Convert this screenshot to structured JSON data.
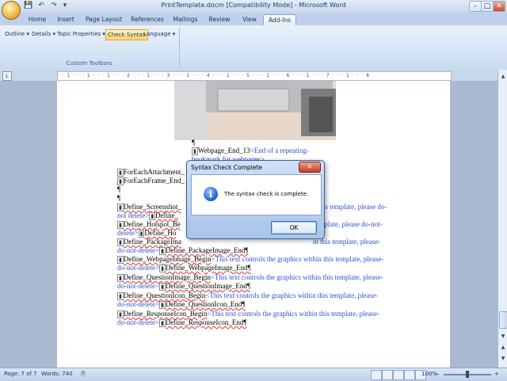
{
  "window": {
    "title": "PrintTemplate.docm [Compatibility Mode] - Microsoft Word"
  },
  "quick_access": {
    "save": "💾",
    "undo": "↶",
    "redo": "↷",
    "more": "▾"
  },
  "window_controls": {
    "minimize": "–",
    "maximize": "□",
    "close": "✕"
  },
  "tabs": [
    {
      "label": "Home"
    },
    {
      "label": "Insert"
    },
    {
      "label": "Page Layout"
    },
    {
      "label": "References"
    },
    {
      "label": "Mailings"
    },
    {
      "label": "Review"
    },
    {
      "label": "View"
    },
    {
      "label": "Add-Ins",
      "active": true
    }
  ],
  "ribbon": {
    "buttons": [
      {
        "label": "Outline ▾"
      },
      {
        "label": "Details ▾"
      },
      {
        "label": "Topic Properties ▾"
      },
      {
        "label": "Check Syntax",
        "highlighted": true
      },
      {
        "label": "Language ▾"
      }
    ],
    "group_label": "Custom Toolbars"
  },
  "ruler": {
    "ticks": "· · 1 · · · 1 · · · 1 · · · 2 · · · 1 · · · 3 · · · 1 · · · 4 · · · 1 · · · 5 · · · 1 · · · 6 · · · 1 · · · 7 · · · 1 · · · 8"
  },
  "document": {
    "webpage_end": {
      "marker": "¶",
      "tag": "Webpage_End_13",
      "note": "<End of a repeating-",
      "note2": "bookmark for webpages>"
    },
    "lines": [
      {
        "text": "ForEachAttachment_"
      },
      {
        "text": "ForEachFrame_End_"
      },
      {
        "text": "¶"
      },
      {
        "text": "¶"
      },
      {
        "text": "Define_Screenshot_",
        "note": "this template, please do-",
        "tail": "Define_"
      },
      {
        "text": "not delete>",
        "tail": "Define_"
      },
      {
        "text": "Define_Hotspot_Be",
        "note": "template, please do-not-"
      },
      {
        "text": "delete>",
        "tail": "Define_Ho"
      },
      {
        "text": "Define_PackageIma",
        "note": "in this template, please-"
      },
      {
        "text": "do-not-delete>",
        "tail": "Define_PackageImage_End¶"
      },
      {
        "text": "Define_WebpageImage_Begin",
        "note": "<This text controls the graphics within this template, please-"
      },
      {
        "text": "do-not-delete>",
        "tail": "Define_WebpageImage_End¶"
      },
      {
        "text": "Define_QuestionImage_Begin",
        "note": "<This text controls the graphics within this template, please-"
      },
      {
        "text": "do-not-delete>",
        "tail": "Define_QuestionImage_End¶"
      },
      {
        "text": "Define_QuestionIcon_Begin",
        "note": "<This text controls the graphics within this template, please-"
      },
      {
        "text": "do-not-delete>",
        "tail": "Define_QuestionIcon_End¶"
      },
      {
        "text": "Define_ResponseIcon_Begin",
        "note": "<This text controls the graphics within this template, please-"
      },
      {
        "text": "do-not-delete>",
        "tail": "Define_ResponseIcon_End¶"
      }
    ]
  },
  "dialog": {
    "title": "Syntax Check Complete",
    "close": "✕",
    "icon": "info-icon",
    "icon_glyph": "i",
    "message": "The syntax check is complete.",
    "ok_label": "OK"
  },
  "statusbar": {
    "page": "Page: 7 of 7",
    "words": "Words: 740",
    "proofing": "🗎",
    "zoom": "100%",
    "zoom_minus": "–",
    "zoom_plus": "+"
  },
  "scrollbar": {
    "up": "▲",
    "down": "▼",
    "prev": "▲",
    "next": "▼"
  },
  "colors": {
    "accent": "#ffd36a",
    "field_text": "#2f4fd0",
    "ribbon": "#d4e2f4"
  }
}
